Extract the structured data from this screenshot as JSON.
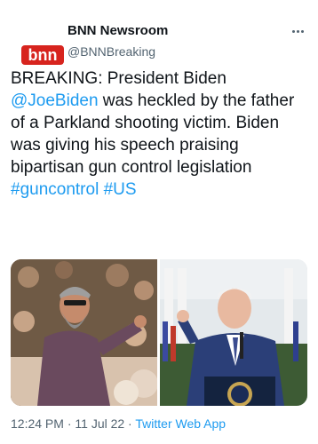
{
  "account": {
    "logo_text": "bnn",
    "name": "BNN Newsroom",
    "handle": "@BNNBreaking"
  },
  "tweet": {
    "part1": "BREAKING: President Biden ",
    "mention": "@JoeBiden",
    "part2": " was heckled by the father of a Parkland shooting victim. Biden was giving his speech praising bipartisan gun control legislation ",
    "hashtag1": "#guncontrol",
    "space": " ",
    "hashtag2": "#US"
  },
  "meta": {
    "time": "12:24 PM",
    "sep1": " · ",
    "date": "11 Jul 22",
    "sep2": " · ",
    "app": "Twitter Web App"
  },
  "colors": {
    "link": "#1d9bf0",
    "brand": "#d7241e",
    "secondary_text": "#536471"
  },
  "icons": [
    "bnn-logo-icon",
    "more-options-icon"
  ]
}
